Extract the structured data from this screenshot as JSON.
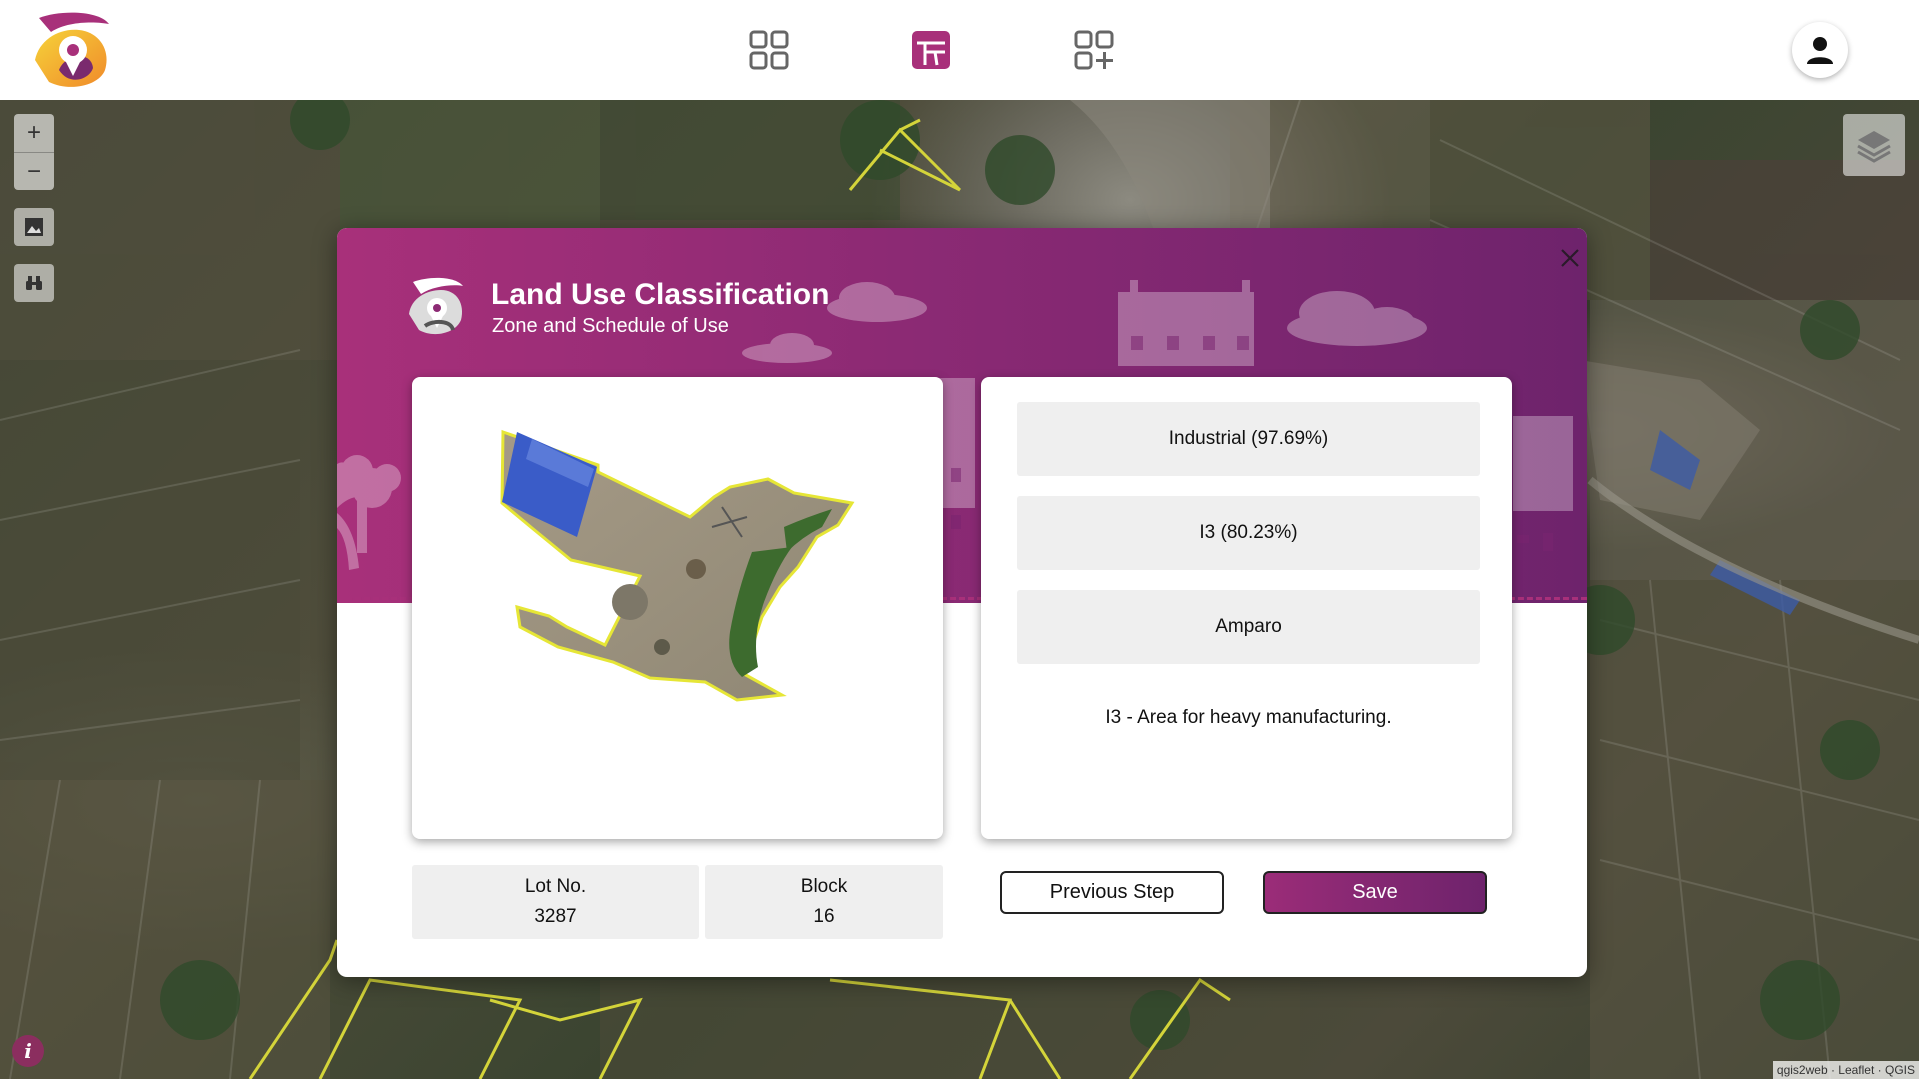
{
  "app": {
    "brand_colors": {
      "primary": "#a8307a",
      "secondary": "#6e236c",
      "logo_orange": "#f08a2a",
      "logo_yellow": "#f6d33a"
    }
  },
  "navbar": {
    "icons": [
      "logo-icon",
      "grid-icon",
      "land-use-icon",
      "grid-plus-icon",
      "user-icon"
    ]
  },
  "map": {
    "controls": {
      "zoom_in": "+",
      "zoom_out": "−"
    },
    "attribution": "qgis2web · Leaflet · QGIS",
    "info_label": "i"
  },
  "modal": {
    "title": "Land Use Classification",
    "subtitle": "Zone and Schedule of Use",
    "classification": "Industrial (97.69%)",
    "zone": "I3 (80.23%)",
    "barangay": "Amparo",
    "description": "I3 - Area for heavy manufacturing.",
    "lot": {
      "label": "Lot No.",
      "value": "3287"
    },
    "block": {
      "label": "Block",
      "value": "16"
    },
    "buttons": {
      "previous": "Previous Step",
      "save": "Save"
    }
  }
}
